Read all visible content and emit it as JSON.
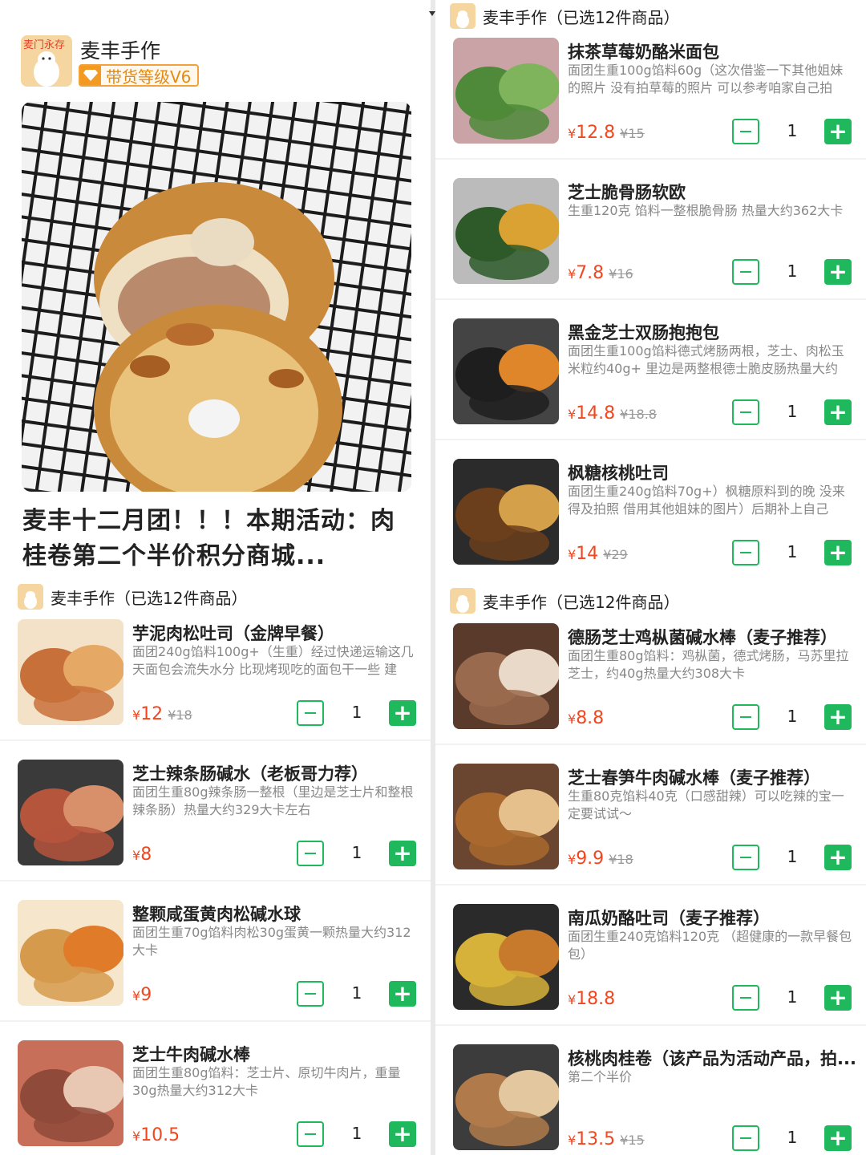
{
  "store": {
    "name": "麦丰手作",
    "level_badge": "带货等级V6",
    "logo_text": "麦门永存"
  },
  "post": {
    "title": "麦丰十二月团！！！本期活动：肉桂卷第二个半价积分商城..."
  },
  "group_title": "麦丰手作（已选12件商品）",
  "currency": "¥",
  "left_items": [
    {
      "name": "芋泥肉松吐司（金牌早餐）",
      "desc": "面团240g馅料100g+（生重）经过快递运输这几天面包会流失水分 比现烤现吃的面包干一些 建",
      "price": "12",
      "orig": "¥18",
      "qty": "1"
    },
    {
      "name": "芝士辣条肠碱水（老板哥力荐）",
      "desc": "面团生重80g辣条肠一整根（里边是芝士片和整根辣条肠）热量大约329大卡左右",
      "price": "8",
      "orig": "",
      "qty": "1"
    },
    {
      "name": "整颗咸蛋黄肉松碱水球",
      "desc": "面团生重70g馅料肉松30g蛋黄一颗热量大约312大卡",
      "price": "9",
      "orig": "",
      "qty": "1"
    },
    {
      "name": "芝士牛肉碱水棒",
      "desc": "面团生重80g馅料：芝士片、原切牛肉片，重量30g热量大约312大卡",
      "price": "10.5",
      "orig": "",
      "qty": "1"
    }
  ],
  "right_items_a": [
    {
      "name": "抹茶草莓奶酪米面包",
      "desc": "面团生重100g馅料60g（这次借鉴一下其他姐妹的照片 没有拍草莓的照片 可以参考咱家自己拍",
      "price": "12.8",
      "orig": "¥15",
      "qty": "1"
    },
    {
      "name": "芝士脆骨肠软欧",
      "desc": "生重120克 馅料一整根脆骨肠 热量大约362大卡",
      "price": "7.8",
      "orig": "¥16",
      "qty": "1"
    },
    {
      "name": "黑金芝士双肠抱抱包",
      "desc": "面团生重100g馅料德式烤肠两根，芝士、肉松玉米粒约40g+ 里边是两整根德士脆皮肠热量大约",
      "price": "14.8",
      "orig": "¥18.8",
      "qty": "1"
    },
    {
      "name": "枫糖核桃吐司",
      "desc": "面团生重240g馅料70g+）枫糖原料到的晚 没来得及拍照 借用其他姐妹的图片）后期补上自己",
      "price": "14",
      "orig": "¥29",
      "qty": "1"
    }
  ],
  "right_items_b": [
    {
      "name": "德肠芝士鸡枞菌碱水棒（麦子推荐）",
      "desc": "面团生重80g馅料：鸡枞菌，德式烤肠，马苏里拉芝士，约40g热量大约308大卡",
      "price": "8.8",
      "orig": "",
      "qty": "1"
    },
    {
      "name": "芝士春笋牛肉碱水棒（麦子推荐）",
      "desc": "生重80克馅料40克（口感甜辣）可以吃辣的宝一定要试试～",
      "price": "9.9",
      "orig": "¥18",
      "qty": "1"
    },
    {
      "name": "南瓜奶酪吐司（麦子推荐）",
      "desc": "面团生重240克馅料120克 （超健康的一款早餐包包）",
      "price": "18.8",
      "orig": "",
      "qty": "1"
    },
    {
      "name": "核桃肉桂卷（该产品为活动产品，拍...",
      "desc": "第二个半价",
      "price": "13.5",
      "orig": "¥15",
      "qty": "1"
    }
  ],
  "colors": {
    "accent_green": "#1fb85c",
    "price_red": "#f2461f",
    "badge_orange": "#f3a23b"
  }
}
